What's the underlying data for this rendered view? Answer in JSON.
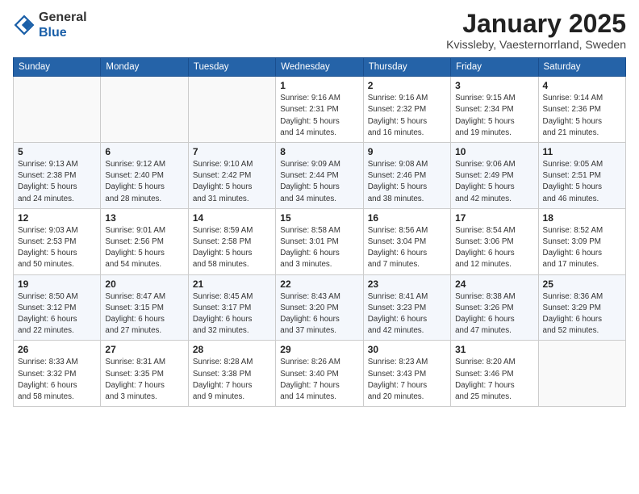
{
  "header": {
    "logo_line1": "General",
    "logo_line2": "Blue",
    "month": "January 2025",
    "location": "Kvissleby, Vaesternorrland, Sweden"
  },
  "weekdays": [
    "Sunday",
    "Monday",
    "Tuesday",
    "Wednesday",
    "Thursday",
    "Friday",
    "Saturday"
  ],
  "weeks": [
    [
      {
        "day": "",
        "info": ""
      },
      {
        "day": "",
        "info": ""
      },
      {
        "day": "",
        "info": ""
      },
      {
        "day": "1",
        "info": "Sunrise: 9:16 AM\nSunset: 2:31 PM\nDaylight: 5 hours\nand 14 minutes."
      },
      {
        "day": "2",
        "info": "Sunrise: 9:16 AM\nSunset: 2:32 PM\nDaylight: 5 hours\nand 16 minutes."
      },
      {
        "day": "3",
        "info": "Sunrise: 9:15 AM\nSunset: 2:34 PM\nDaylight: 5 hours\nand 19 minutes."
      },
      {
        "day": "4",
        "info": "Sunrise: 9:14 AM\nSunset: 2:36 PM\nDaylight: 5 hours\nand 21 minutes."
      }
    ],
    [
      {
        "day": "5",
        "info": "Sunrise: 9:13 AM\nSunset: 2:38 PM\nDaylight: 5 hours\nand 24 minutes."
      },
      {
        "day": "6",
        "info": "Sunrise: 9:12 AM\nSunset: 2:40 PM\nDaylight: 5 hours\nand 28 minutes."
      },
      {
        "day": "7",
        "info": "Sunrise: 9:10 AM\nSunset: 2:42 PM\nDaylight: 5 hours\nand 31 minutes."
      },
      {
        "day": "8",
        "info": "Sunrise: 9:09 AM\nSunset: 2:44 PM\nDaylight: 5 hours\nand 34 minutes."
      },
      {
        "day": "9",
        "info": "Sunrise: 9:08 AM\nSunset: 2:46 PM\nDaylight: 5 hours\nand 38 minutes."
      },
      {
        "day": "10",
        "info": "Sunrise: 9:06 AM\nSunset: 2:49 PM\nDaylight: 5 hours\nand 42 minutes."
      },
      {
        "day": "11",
        "info": "Sunrise: 9:05 AM\nSunset: 2:51 PM\nDaylight: 5 hours\nand 46 minutes."
      }
    ],
    [
      {
        "day": "12",
        "info": "Sunrise: 9:03 AM\nSunset: 2:53 PM\nDaylight: 5 hours\nand 50 minutes."
      },
      {
        "day": "13",
        "info": "Sunrise: 9:01 AM\nSunset: 2:56 PM\nDaylight: 5 hours\nand 54 minutes."
      },
      {
        "day": "14",
        "info": "Sunrise: 8:59 AM\nSunset: 2:58 PM\nDaylight: 5 hours\nand 58 minutes."
      },
      {
        "day": "15",
        "info": "Sunrise: 8:58 AM\nSunset: 3:01 PM\nDaylight: 6 hours\nand 3 minutes."
      },
      {
        "day": "16",
        "info": "Sunrise: 8:56 AM\nSunset: 3:04 PM\nDaylight: 6 hours\nand 7 minutes."
      },
      {
        "day": "17",
        "info": "Sunrise: 8:54 AM\nSunset: 3:06 PM\nDaylight: 6 hours\nand 12 minutes."
      },
      {
        "day": "18",
        "info": "Sunrise: 8:52 AM\nSunset: 3:09 PM\nDaylight: 6 hours\nand 17 minutes."
      }
    ],
    [
      {
        "day": "19",
        "info": "Sunrise: 8:50 AM\nSunset: 3:12 PM\nDaylight: 6 hours\nand 22 minutes."
      },
      {
        "day": "20",
        "info": "Sunrise: 8:47 AM\nSunset: 3:15 PM\nDaylight: 6 hours\nand 27 minutes."
      },
      {
        "day": "21",
        "info": "Sunrise: 8:45 AM\nSunset: 3:17 PM\nDaylight: 6 hours\nand 32 minutes."
      },
      {
        "day": "22",
        "info": "Sunrise: 8:43 AM\nSunset: 3:20 PM\nDaylight: 6 hours\nand 37 minutes."
      },
      {
        "day": "23",
        "info": "Sunrise: 8:41 AM\nSunset: 3:23 PM\nDaylight: 6 hours\nand 42 minutes."
      },
      {
        "day": "24",
        "info": "Sunrise: 8:38 AM\nSunset: 3:26 PM\nDaylight: 6 hours\nand 47 minutes."
      },
      {
        "day": "25",
        "info": "Sunrise: 8:36 AM\nSunset: 3:29 PM\nDaylight: 6 hours\nand 52 minutes."
      }
    ],
    [
      {
        "day": "26",
        "info": "Sunrise: 8:33 AM\nSunset: 3:32 PM\nDaylight: 6 hours\nand 58 minutes."
      },
      {
        "day": "27",
        "info": "Sunrise: 8:31 AM\nSunset: 3:35 PM\nDaylight: 7 hours\nand 3 minutes."
      },
      {
        "day": "28",
        "info": "Sunrise: 8:28 AM\nSunset: 3:38 PM\nDaylight: 7 hours\nand 9 minutes."
      },
      {
        "day": "29",
        "info": "Sunrise: 8:26 AM\nSunset: 3:40 PM\nDaylight: 7 hours\nand 14 minutes."
      },
      {
        "day": "30",
        "info": "Sunrise: 8:23 AM\nSunset: 3:43 PM\nDaylight: 7 hours\nand 20 minutes."
      },
      {
        "day": "31",
        "info": "Sunrise: 8:20 AM\nSunset: 3:46 PM\nDaylight: 7 hours\nand 25 minutes."
      },
      {
        "day": "",
        "info": ""
      }
    ]
  ]
}
